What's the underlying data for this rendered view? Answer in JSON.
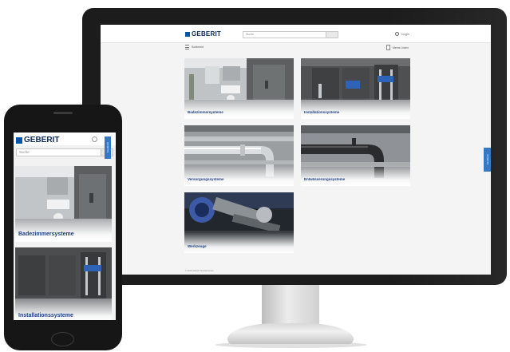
{
  "colors": {
    "brand": "#0057a8",
    "link_blue": "#1e3f82",
    "feedback_tab": "#3778c4"
  },
  "desktop": {
    "logo": "GEBERIT",
    "search_placeholder": "Suche",
    "login_label": "Login",
    "sortiment_label": "Sortiment",
    "sortiment_icon": "hamburger-icon",
    "right_link": "Meine Listen",
    "cards": [
      {
        "label": "Badezimmersysteme"
      },
      {
        "label": "Installationssysteme"
      },
      {
        "label": "Versorgungssysteme"
      },
      {
        "label": "Entwässerungssysteme"
      },
      {
        "label": "Werkzeuge"
      }
    ],
    "feedback": "Feedback",
    "footer": "© 2018 Geberit International AG"
  },
  "mobile": {
    "logo": "GEBERIT",
    "search_placeholder": "Suche",
    "cards": [
      {
        "label": "Badezimmersysteme"
      },
      {
        "label": "Installationssysteme"
      }
    ],
    "feedback": "Feedback"
  }
}
